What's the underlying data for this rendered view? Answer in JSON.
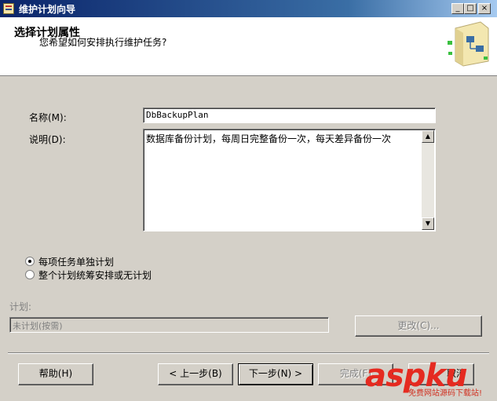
{
  "window": {
    "title": "维护计划向导",
    "minimize_glyph": "_",
    "maximize_glyph": "□",
    "close_glyph": "×"
  },
  "header": {
    "title": "选择计划属性",
    "subtitle": "您希望如何安排执行维护任务?"
  },
  "form": {
    "name_label": "名称(M):",
    "name_value": "DbBackupPlan",
    "description_label": "说明(D):",
    "description_value": "数据库备份计划，每周日完整备份一次，每天差异备份一次"
  },
  "options": {
    "items": [
      {
        "label": "每项任务单独计划",
        "checked": true
      },
      {
        "label": "整个计划统筹安排或无计划",
        "checked": false
      }
    ]
  },
  "schedule": {
    "label": "计划:",
    "value": "未计划(按需)",
    "change_button": "更改(C)..."
  },
  "footer": {
    "help_button": "帮助(H)",
    "back_button": "< 上一步(B)",
    "next_button": "下一步(N) >",
    "finish_button": "完成(F)",
    "cancel_button": "取消"
  },
  "watermark": {
    "brand": "aspku",
    "tagline": "免费网站源码下载站!"
  },
  "colors": {
    "titlebar_start": "#0a246a",
    "titlebar_end": "#a6caf0",
    "face": "#d4d0c8",
    "watermark": "#e52a20"
  }
}
